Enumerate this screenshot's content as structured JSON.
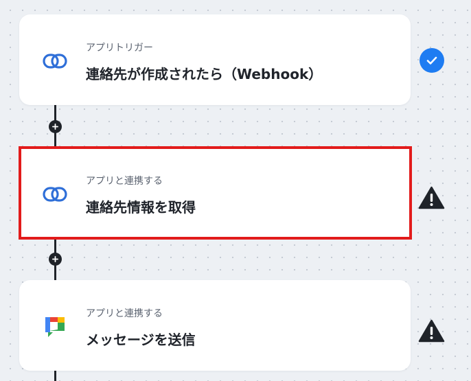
{
  "flow": {
    "steps": [
      {
        "type_label": "アプリトリガー",
        "title": "連絡先が作成されたら（Webhook）",
        "app_icon": "link-rings-icon",
        "status": "complete"
      },
      {
        "type_label": "アプリと連携する",
        "title": "連絡先情報を取得",
        "app_icon": "link-rings-icon",
        "status": "warning",
        "selected": true
      },
      {
        "type_label": "アプリと連携する",
        "title": "メッセージを送信",
        "app_icon": "google-chat-icon",
        "status": "warning"
      }
    ]
  },
  "colors": {
    "selection_border": "#e21b1b",
    "check_badge": "#1e7cf2",
    "connector": "#1f2329",
    "canvas_background": "#edf0f4"
  }
}
